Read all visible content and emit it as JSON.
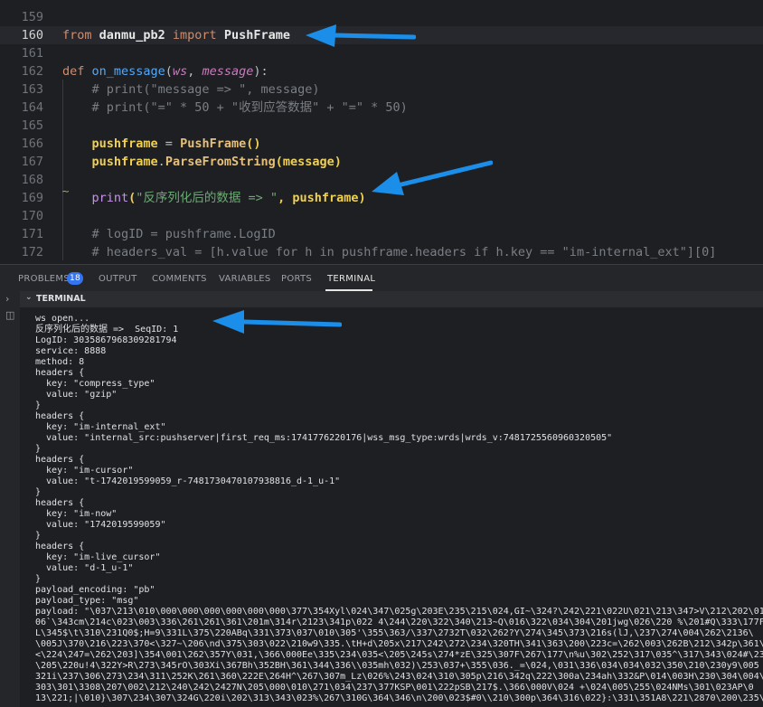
{
  "editor": {
    "lines": [
      {
        "num": "159",
        "current": false,
        "tokens": []
      },
      {
        "num": "160",
        "current": true,
        "tokens": [
          {
            "t": "from",
            "c": "tok-kw"
          },
          {
            "t": " danmu_pb2 ",
            "c": "tok-bold"
          },
          {
            "t": "import",
            "c": "tok-kw"
          },
          {
            "t": " PushFrame",
            "c": "tok-bold"
          }
        ]
      },
      {
        "num": "161",
        "current": false,
        "tokens": []
      },
      {
        "num": "162",
        "current": false,
        "tokens": [
          {
            "t": "def ",
            "c": "tok-kw"
          },
          {
            "t": "on_message",
            "c": "tok-fn"
          },
          {
            "t": "(",
            "c": "tok-plain"
          },
          {
            "t": "ws",
            "c": "tok-param"
          },
          {
            "t": ", ",
            "c": "tok-plain"
          },
          {
            "t": "message",
            "c": "tok-param"
          },
          {
            "t": "):",
            "c": "tok-plain"
          }
        ]
      },
      {
        "num": "163",
        "current": false,
        "tokens": [
          {
            "t": "    # print(\"message => \", message)",
            "c": "tok-cmt"
          }
        ]
      },
      {
        "num": "164",
        "current": false,
        "tokens": [
          {
            "t": "    # print(\"=\" * 50 + \"收到应答数据\" + \"=\" * 50)",
            "c": "tok-cmt"
          }
        ]
      },
      {
        "num": "165",
        "current": false,
        "tokens": []
      },
      {
        "num": "166",
        "current": false,
        "tokens": [
          {
            "t": "    pushframe",
            "c": "tok-yellow"
          },
          {
            "t": " = ",
            "c": "tok-plain"
          },
          {
            "t": "PushFrame",
            "c": "tok-meth"
          },
          {
            "t": "()",
            "c": "tok-yellow"
          }
        ]
      },
      {
        "num": "167",
        "current": false,
        "tokens": [
          {
            "t": "    pushframe",
            "c": "tok-yellow"
          },
          {
            "t": ".",
            "c": "tok-plain"
          },
          {
            "t": "ParseFromString",
            "c": "tok-meth"
          },
          {
            "t": "(message)",
            "c": "tok-yellow"
          }
        ]
      },
      {
        "num": "168",
        "current": false,
        "tokens": []
      },
      {
        "num": "169",
        "current": false,
        "tokens": [
          {
            "t": "    ",
            "c": "tok-plain"
          },
          {
            "t": "print",
            "c": "tok-builtin"
          },
          {
            "t": "(",
            "c": "tok-yellow"
          },
          {
            "t": "\"反序列化后的数据 => \"",
            "c": "tok-str"
          },
          {
            "t": ", pushframe)",
            "c": "tok-yellow"
          }
        ]
      },
      {
        "num": "170",
        "current": false,
        "tokens": []
      },
      {
        "num": "171",
        "current": false,
        "tokens": [
          {
            "t": "    # logID = pushframe.LogID",
            "c": "tok-cmt"
          }
        ]
      },
      {
        "num": "172",
        "current": false,
        "tokens": [
          {
            "t": "    # headers_val = [h.value for h in pushframe.headers if h.key == \"im-internal_ext\"][0]",
            "c": "tok-cmt"
          }
        ]
      }
    ]
  },
  "panel": {
    "tabs": [
      {
        "label": "PROBLEMS",
        "name": "tab-problems",
        "active": false
      },
      {
        "label": "OUTPUT",
        "name": "tab-output",
        "active": false
      },
      {
        "label": "COMMENTS",
        "name": "tab-comments",
        "active": false
      },
      {
        "label": "VARIABLES",
        "name": "tab-variables",
        "active": false
      },
      {
        "label": "PORTS",
        "name": "tab-ports",
        "active": false
      },
      {
        "label": "TERMINAL",
        "name": "tab-terminal",
        "active": true
      }
    ],
    "problems_count": "18",
    "terminal_title": "TERMINAL"
  },
  "terminal": {
    "lines": [
      "ws open...",
      "反序列化后的数据 =>  SeqID: 1",
      "LogID: 3035867968309281794",
      "service: 8888",
      "method: 8",
      "headers {",
      "  key: \"compress_type\"",
      "  value: \"gzip\"",
      "}",
      "headers {",
      "  key: \"im-internal_ext\"",
      "  value: \"internal_src:pushserver|first_req_ms:1741776220176|wss_msg_type:wrds|wrds_v:7481725560960320505\"",
      "}",
      "headers {",
      "  key: \"im-cursor\"",
      "  value: \"t-1742019599059_r-7481730470107938816_d-1_u-1\"",
      "}",
      "headers {",
      "  key: \"im-now\"",
      "  value: \"1742019599059\"",
      "}",
      "headers {",
      "  key: \"im-live_cursor\"",
      "  value: \"d-1_u-1\"",
      "}",
      "payload_encoding: \"pb\"",
      "payload_type: \"msg\"",
      "payload: \"\\037\\213\\010\\000\\000\\000\\000\\000\\000\\377\\354Xyl\\024\\347\\025g\\203E\\235\\215\\024,GI~\\324?\\242\\221\\022U\\021\\213\\347>V\\212\\202\\01",
      "06`\\343cm\\214c\\023\\003\\336\\261\\261\\361\\201m\\314r\\2123\\341p\\022 4\\244\\220\\322\\340\\213~Q\\016\\322\\034\\304\\201jwg\\026\\220 %\\201#Q\\333\\177F",
      "L\\345$\\t\\310\\231Q0$;H=9\\331L\\375\\220ABq\\331\\373\\037\\010\\305'\\355\\363/\\337\\2732T\\032\\262?Y\\274\\345\\373\\216s(lJ,\\237\\274\\004\\262\\2136\\",
      "\\005J\\370\\216\\223\\370<\\327~\\206\\nd\\375\\303\\022\\210w9\\335.\\tH+d\\205x\\217\\242\\272\\234\\320TH\\341\\363\\200\\223c=\\262\\003\\262B\\212\\342p\\361\\",
      "<\\224\\247=\\262\\203]\\354\\001\\262\\357Y\\031,\\366\\000Ee\\335\\234\\035<\\205\\245s\\274*zE\\325\\307F\\267\\177\\n%u\\302\\252\\317\\035^\\317\\343\\024#\\23",
      "\\205\\220u!4\\322Y>R\\273\\345rO\\303Xi\\367Bh\\352BH\\361\\344\\336\\\\035mh\\032)\\253\\037+\\355\\036._=\\024,\\031\\336\\034\\034\\032\\350\\210\\230y9\\005",
      "321i\\237\\306\\273\\234\\311\\252K\\261\\360\\222E\\264H^\\267\\307m_Lz\\026%\\243\\024\\310\\305p\\216\\342q\\222\\300a\\234ah\\332&P\\014\\003H\\230\\304\\004\\",
      "303\\301\\3308\\207\\002\\212\\240\\242\\2427N\\205\\000\\010\\271\\034\\237\\377KSP\\001\\222pSB\\217$.\\366\\000V\\024 +\\024\\005\\255\\024NMs\\301\\023AP\\0",
      "13\\221;|\\010}\\307\\234\\307\\324G\\220i\\202\\313\\343\\023%\\267\\310G\\364\\346\\n\\200\\023$#0\\\\210\\300p\\364\\316\\022}:\\331\\351A8\\221\\2870\\200\\235\\"
    ]
  }
}
